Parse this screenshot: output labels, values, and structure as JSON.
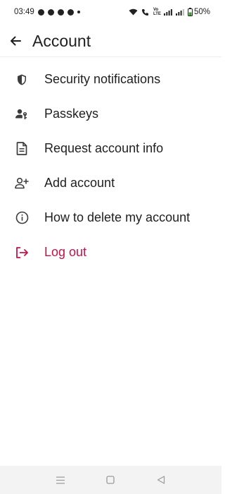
{
  "status_bar": {
    "time": "03:49",
    "network_label": "Vo LTE",
    "battery": "50%"
  },
  "header": {
    "title": "Account",
    "back_icon": "arrow-left-icon"
  },
  "menu": {
    "items": [
      {
        "label": "Security notifications",
        "icon": "shield-icon"
      },
      {
        "label": "Passkeys",
        "icon": "person-key-icon"
      },
      {
        "label": "Request account info",
        "icon": "document-icon"
      },
      {
        "label": "Add account",
        "icon": "person-add-icon"
      },
      {
        "label": "How to delete my account",
        "icon": "info-icon"
      },
      {
        "label": "Log out",
        "icon": "logout-icon"
      }
    ]
  },
  "colors": {
    "text": "#1f1f1f",
    "icon": "#3c3c3c",
    "danger": "#c21349",
    "nav_bar_bg": "#f3f3f3"
  },
  "nav_bar": {
    "buttons": [
      "menu-icon",
      "home-icon",
      "back-triangle-icon"
    ]
  }
}
